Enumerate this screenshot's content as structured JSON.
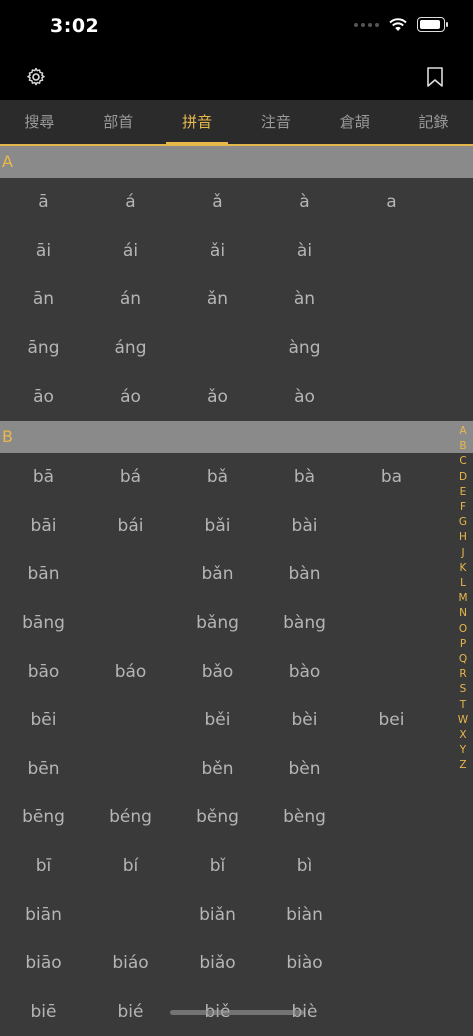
{
  "status": {
    "time": "3:02"
  },
  "tabs": [
    {
      "label": "搜尋"
    },
    {
      "label": "部首"
    },
    {
      "label": "拼音"
    },
    {
      "label": "注音"
    },
    {
      "label": "倉頡"
    },
    {
      "label": "記錄"
    }
  ],
  "colors": {
    "accent": "#e8b84b",
    "background": "#3a3a3a",
    "header": "#8a8a8a"
  },
  "sections": {
    "a": {
      "letter": "A",
      "rows": [
        [
          "ā",
          "á",
          "ǎ",
          "à",
          "a"
        ],
        [
          "āi",
          "ái",
          "ǎi",
          "ài",
          ""
        ],
        [
          "ān",
          "án",
          "ǎn",
          "àn",
          ""
        ],
        [
          "āng",
          "áng",
          "",
          "àng",
          ""
        ],
        [
          "āo",
          "áo",
          "ǎo",
          "ào",
          ""
        ]
      ]
    },
    "b": {
      "letter": "B",
      "rows": [
        [
          "bā",
          "bá",
          "bǎ",
          "bà",
          "ba"
        ],
        [
          "bāi",
          "bái",
          "bǎi",
          "bài",
          ""
        ],
        [
          "bān",
          "",
          "bǎn",
          "bàn",
          ""
        ],
        [
          "bāng",
          "",
          "bǎng",
          "bàng",
          ""
        ],
        [
          "bāo",
          "báo",
          "bǎo",
          "bào",
          ""
        ],
        [
          "bēi",
          "",
          "běi",
          "bèi",
          "bei"
        ],
        [
          "bēn",
          "",
          "běn",
          "bèn",
          ""
        ],
        [
          "bēng",
          "béng",
          "běng",
          "bèng",
          ""
        ],
        [
          "bī",
          "bí",
          "bǐ",
          "bì",
          ""
        ],
        [
          "biān",
          "",
          "biǎn",
          "biàn",
          ""
        ],
        [
          "biāo",
          "biáo",
          "biǎo",
          "biào",
          ""
        ],
        [
          "biē",
          "bié",
          "biě",
          "biè",
          ""
        ]
      ]
    }
  },
  "index": [
    "A",
    "B",
    "C",
    "D",
    "E",
    "F",
    "G",
    "H",
    "J",
    "K",
    "L",
    "M",
    "N",
    "O",
    "P",
    "Q",
    "R",
    "S",
    "T",
    "W",
    "X",
    "Y",
    "Z"
  ]
}
